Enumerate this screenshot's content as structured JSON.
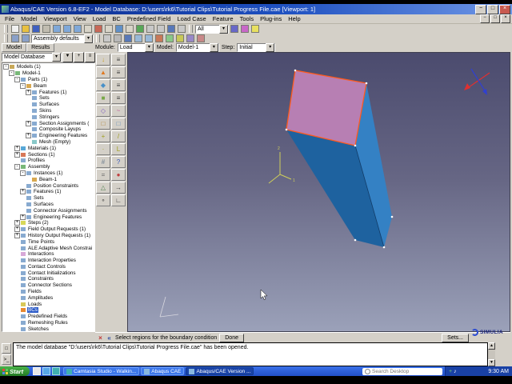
{
  "window": {
    "title": "Abaqus/CAE Version 6.8-EF2 - Model Database: D:\\users\\rk6\\Tutorial Clips\\Tutorial Progress File.cae  [Viewport: 1]",
    "controls": {
      "minimize": "−",
      "maximize": "□",
      "close": "×"
    }
  },
  "menu": {
    "items": [
      "File",
      "Model",
      "Viewport",
      "View",
      "Load",
      "BC",
      "Predefined Field",
      "Load Case",
      "Feature",
      "Tools",
      "Plug-ins",
      "Help"
    ]
  },
  "toolbar_main": {
    "icons": [
      {
        "name": "new-model-icon",
        "color": "#f0f0f0"
      },
      {
        "name": "open-icon",
        "color": "#e8c040"
      },
      {
        "name": "save-icon",
        "color": "#4060c0"
      },
      {
        "name": "print-icon",
        "color": "#c0bcb0"
      },
      {
        "name": "create-viewport-icon",
        "color": "#80a8d8"
      },
      {
        "name": "tile-vertical-icon",
        "color": "#80a8d8"
      },
      {
        "name": "tile-horizontal-icon",
        "color": "#80a8d8"
      },
      {
        "name": "pan-view-icon",
        "color": "#d8d4c8"
      },
      {
        "name": "rotate-view-icon",
        "color": "#c86858"
      },
      {
        "name": "magnify-view-icon",
        "color": "#d8d4c8"
      },
      {
        "name": "fit-view-icon",
        "color": "#6090c8"
      },
      {
        "name": "box-zoom-icon",
        "color": "#d8d4c8"
      },
      {
        "name": "cycle-views-icon",
        "color": "#58a858"
      },
      {
        "name": "front-view-icon",
        "color": "#c8c8c8"
      },
      {
        "name": "iso-view-icon",
        "color": "#c8c8c8"
      },
      {
        "name": "render-shaded-icon",
        "color": "#5878b8"
      },
      {
        "name": "render-wireframe-icon",
        "color": "#c8c8c8"
      }
    ],
    "selector_value": "All",
    "right_icons": [
      {
        "name": "query-info-icon",
        "color": "#6868c8"
      },
      {
        "name": "color-code-icon",
        "color": "#c868c8"
      },
      {
        "name": "help-icon",
        "color": "#e8e060"
      }
    ]
  },
  "toolbar_view": {
    "icons_before": [
      {
        "name": "view-previous-icon",
        "color": "#8aa0c8"
      },
      {
        "name": "view-refresh-icon",
        "color": "#8aa0c8"
      }
    ],
    "combo_value": "Assembly defaults",
    "icons_after": [
      {
        "name": "wireframe-style-icon",
        "color": "#c8c8c8"
      },
      {
        "name": "hidden-line-style-icon",
        "color": "#b8b8b8"
      },
      {
        "name": "shaded-style-icon",
        "color": "#5878b8"
      },
      {
        "name": "perspective-icon",
        "color": "#98b8d8"
      },
      {
        "name": "parallel-projection-icon",
        "color": "#98b8d8"
      },
      {
        "name": "view-cut-icon",
        "color": "#c87858"
      },
      {
        "name": "superimpose-icon",
        "color": "#88c888"
      },
      {
        "name": "datum-display-icon",
        "color": "#c8c858"
      },
      {
        "name": "visible-groups-icon",
        "color": "#9888c8"
      },
      {
        "name": "compass-toggle-icon",
        "color": "#c88888"
      }
    ]
  },
  "tabs": {
    "model": "Model",
    "results": "Results"
  },
  "context": {
    "module_label": "Module:",
    "module_value": "Load",
    "model_label": "Model:",
    "model_value": "Model-1",
    "step_label": "Step:",
    "step_value": "Initial"
  },
  "tree": {
    "combo_value": "Model Database",
    "header_icons": [
      {
        "name": "tree-filter-icon",
        "glyph": "▼"
      },
      {
        "name": "tree-expand-all-icon",
        "glyph": "+"
      },
      {
        "name": "tree-options-icon",
        "glyph": "≡"
      }
    ],
    "items": [
      {
        "l": "Models (1)",
        "d": 0,
        "e": "-",
        "c": "#c8a858"
      },
      {
        "l": "Model-1",
        "d": 1,
        "e": "-",
        "c": "#78b878"
      },
      {
        "l": "Parts (1)",
        "d": 2,
        "e": "-",
        "c": "#88aad0"
      },
      {
        "l": "Beam",
        "d": 3,
        "e": "-",
        "c": "#d8a850"
      },
      {
        "l": "Features (1)",
        "d": 4,
        "e": "+",
        "c": "#88aad0"
      },
      {
        "l": "Sets",
        "d": 4,
        "e": "",
        "c": "#88aad0"
      },
      {
        "l": "Surfaces",
        "d": 4,
        "e": "",
        "c": "#88aad0"
      },
      {
        "l": "Skins",
        "d": 4,
        "e": "",
        "c": "#88aad0"
      },
      {
        "l": "Stringers",
        "d": 4,
        "e": "",
        "c": "#88aad0"
      },
      {
        "l": "Section Assignments (",
        "d": 4,
        "e": "+",
        "c": "#88aad0"
      },
      {
        "l": "Composite Layups",
        "d": 4,
        "e": "",
        "c": "#88aad0"
      },
      {
        "l": "Engineering Features",
        "d": 4,
        "e": "+",
        "c": "#88aad0"
      },
      {
        "l": "Mesh (Empty)",
        "d": 4,
        "e": "",
        "c": "#88c8c8"
      },
      {
        "l": "Materials (1)",
        "d": 2,
        "e": "+",
        "c": "#58a8d8"
      },
      {
        "l": "Sections (1)",
        "d": 2,
        "e": "+",
        "c": "#d87858"
      },
      {
        "l": "Profiles",
        "d": 2,
        "e": "",
        "c": "#88aad0"
      },
      {
        "l": "Assembly",
        "d": 2,
        "e": "-",
        "c": "#78b878"
      },
      {
        "l": "Instances (1)",
        "d": 3,
        "e": "-",
        "c": "#88aad0"
      },
      {
        "l": "Beam-1",
        "d": 4,
        "e": "",
        "c": "#d8a850"
      },
      {
        "l": "Position Constraints",
        "d": 3,
        "e": "",
        "c": "#88aad0"
      },
      {
        "l": "Features (1)",
        "d": 3,
        "e": "+",
        "c": "#88aad0"
      },
      {
        "l": "Sets",
        "d": 3,
        "e": "",
        "c": "#88aad0"
      },
      {
        "l": "Surfaces",
        "d": 3,
        "e": "",
        "c": "#88aad0"
      },
      {
        "l": "Connector Assignments",
        "d": 3,
        "e": "",
        "c": "#88aad0"
      },
      {
        "l": "Engineering Features",
        "d": 3,
        "e": "+",
        "c": "#88aad0"
      },
      {
        "l": "Steps (2)",
        "d": 2,
        "e": "+",
        "c": "#d8d858"
      },
      {
        "l": "Field Output Requests (1)",
        "d": 2,
        "e": "+",
        "c": "#88aad0"
      },
      {
        "l": "History Output Requests (1)",
        "d": 2,
        "e": "+",
        "c": "#88aad0"
      },
      {
        "l": "Time Points",
        "d": 2,
        "e": "",
        "c": "#88aad0"
      },
      {
        "l": "ALE Adaptive Mesh Constrai",
        "d": 2,
        "e": "",
        "c": "#88aad0"
      },
      {
        "l": "Interactions",
        "d": 2,
        "e": "",
        "c": "#d8a8d8"
      },
      {
        "l": "Interaction Properties",
        "d": 2,
        "e": "",
        "c": "#88aad0"
      },
      {
        "l": "Contact Controls",
        "d": 2,
        "e": "",
        "c": "#88aad0"
      },
      {
        "l": "Contact Initializations",
        "d": 2,
        "e": "",
        "c": "#88aad0"
      },
      {
        "l": "Constraints",
        "d": 2,
        "e": "",
        "c": "#88aad0"
      },
      {
        "l": "Connector Sections",
        "d": 2,
        "e": "",
        "c": "#88aad0"
      },
      {
        "l": "Fields",
        "d": 2,
        "e": "",
        "c": "#88aad0"
      },
      {
        "l": "Amplitudes",
        "d": 2,
        "e": "",
        "c": "#88aad0"
      },
      {
        "l": "Loads",
        "d": 2,
        "e": "",
        "c": "#d8c858"
      },
      {
        "l": "BCs",
        "d": 2,
        "e": "",
        "s": true,
        "c": "#e88830"
      },
      {
        "l": "Predefined Fields",
        "d": 2,
        "e": "",
        "c": "#88aad0"
      },
      {
        "l": "Remeshing Rules",
        "d": 2,
        "e": "",
        "c": "#88aad0"
      },
      {
        "l": "Sketches",
        "d": 2,
        "e": "",
        "c": "#88aad0"
      }
    ]
  },
  "toolbox": {
    "buttons": [
      {
        "name": "create-load-icon",
        "glyph": "↓",
        "color": "#c8a020"
      },
      {
        "name": "load-manager-icon",
        "glyph": "≡",
        "color": "#404040"
      },
      {
        "name": "create-bc-icon",
        "glyph": "▲",
        "color": "#e07820"
      },
      {
        "name": "bc-manager-icon",
        "glyph": "≡",
        "color": "#404040"
      },
      {
        "name": "create-predefined-field-icon",
        "glyph": "◆",
        "color": "#4890c8"
      },
      {
        "name": "predefined-field-manager-icon",
        "glyph": "≡",
        "color": "#404040"
      },
      {
        "name": "create-load-case-icon",
        "glyph": "■",
        "color": "#78a848"
      },
      {
        "name": "load-case-manager-icon",
        "glyph": "≡",
        "color": "#404040"
      },
      {
        "name": "create-field-icon",
        "glyph": "◇",
        "color": "#8060c0"
      },
      {
        "name": "create-amplitude-icon",
        "glyph": "~",
        "color": "#c05898"
      },
      {
        "name": "create-set-icon",
        "glyph": "□",
        "color": "#b08030"
      },
      {
        "name": "create-surface-icon",
        "glyph": "□",
        "color": "#5888b8"
      },
      {
        "name": "create-datum-plane-icon",
        "glyph": "+",
        "color": "#a0a020"
      },
      {
        "name": "create-datum-axis-icon",
        "glyph": "/",
        "color": "#a0a020"
      },
      {
        "name": "create-datum-point-icon",
        "glyph": "·",
        "color": "#a0a020"
      },
      {
        "name": "create-datum-csys-icon",
        "glyph": "L",
        "color": "#a0a020"
      },
      {
        "name": "partition-cell-icon",
        "glyph": "#",
        "color": "#708090"
      },
      {
        "name": "query-information-icon",
        "glyph": "?",
        "color": "#3858b8"
      },
      {
        "name": "display-group-icon",
        "glyph": "=",
        "color": "#606060"
      },
      {
        "name": "color-code-icon",
        "glyph": "●",
        "color": "#c04040"
      },
      {
        "name": "edit-mesh-icon",
        "glyph": "△",
        "color": "#508050"
      },
      {
        "name": "translate-instance-icon",
        "glyph": "→",
        "color": "#404040"
      },
      {
        "name": "rotate-instance-icon",
        "glyph": "∘",
        "color": "#404040"
      },
      {
        "name": "measure-icon",
        "glyph": "∟",
        "color": "#404040"
      }
    ]
  },
  "viewport": {
    "colors": {
      "bg_top": "#4b4b6e",
      "bg_mid": "#666684",
      "bg_bottom": "#9ba1b9",
      "beam_front": "#1e629f",
      "beam_right": "#3481c4",
      "beam_top": "#b77fb3",
      "highlight": "#ff5a1e",
      "edge": "#123c68",
      "datum": "#cfcf5a",
      "triad": "#d8d8e0",
      "compass_x": "#e03030",
      "compass_z": "#3040d0"
    },
    "datum_labels": {
      "a1": "1",
      "a2": "2"
    }
  },
  "prompt": {
    "icons": [
      {
        "name": "cancel-prompt-icon",
        "glyph": "×",
        "color": "#c03030"
      },
      {
        "name": "previous-step-icon",
        "glyph": "«",
        "color": "#2a4aa0"
      }
    ],
    "text": "Select regions for the boundary condition",
    "done_label": "Done",
    "sets_label": "Sets..."
  },
  "logo": {
    "text": "SIMULIA"
  },
  "message": {
    "tabs": [
      {
        "name": "message-area-tab",
        "glyph": "□"
      },
      {
        "name": "command-line-tab",
        "glyph": ">_"
      }
    ],
    "text": "The model database \"D:\\users\\rk6\\Tutorial Clips\\Tutorial Progress File.cae\" has been opened."
  },
  "taskbar": {
    "start_label": "Start",
    "quick_launch": [
      {
        "name": "show-desktop-icon",
        "color": "#e8e8e8"
      },
      {
        "name": "internet-explorer-icon",
        "color": "#58a8e8"
      },
      {
        "name": "camtasia-quicklaunch-icon",
        "color": "#40b0b0"
      }
    ],
    "buttons": [
      {
        "name": "task-camtasia",
        "label": "Camtasia Studio - Walkin...",
        "icon_color": "#40b0b0"
      },
      {
        "name": "task-abaqus-cae",
        "label": "Abaqus CAE",
        "icon_color": "#88b8e0"
      },
      {
        "name": "task-abaqus-version",
        "label": "Abaqus/CAE Version ...",
        "icon_color": "#88b8e0",
        "active": true
      }
    ],
    "search_placeholder": "Search Desktop",
    "tray": {
      "icons": [
        {
          "name": "antivirus-tray-icon",
          "glyph": "+",
          "color": "#70c870"
        },
        {
          "name": "volume-tray-icon",
          "glyph": "♪",
          "color": "#ffffff"
        }
      ],
      "time": "9:30 AM"
    }
  }
}
